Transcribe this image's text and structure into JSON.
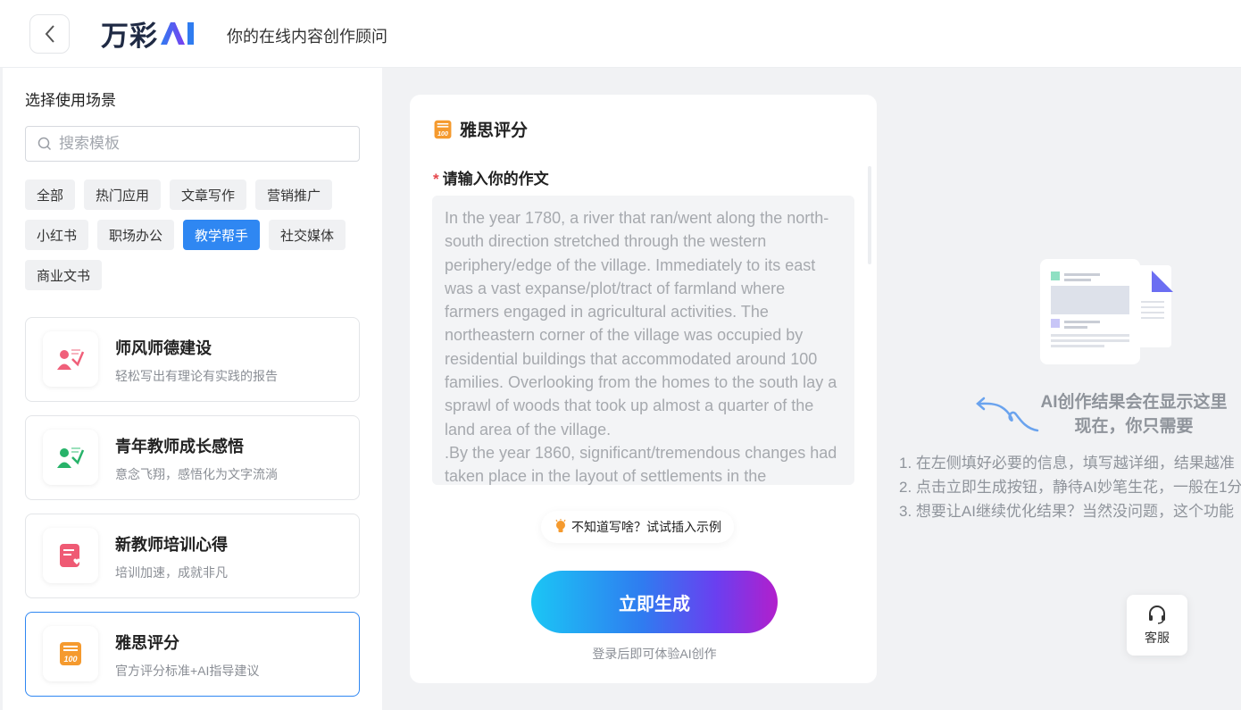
{
  "header": {
    "logo_text": "万彩",
    "logo_ai": "AI",
    "tagline": "你的在线内容创作顾问"
  },
  "sidebar": {
    "title": "选择使用场景",
    "search_placeholder": "搜索模板",
    "tags": [
      {
        "label": "全部",
        "active": false
      },
      {
        "label": "热门应用",
        "active": false
      },
      {
        "label": "文章写作",
        "active": false
      },
      {
        "label": "营销推广",
        "active": false
      },
      {
        "label": "小红书",
        "active": false
      },
      {
        "label": "职场办公",
        "active": false
      },
      {
        "label": "教学帮手",
        "active": true
      },
      {
        "label": "社交媒体",
        "active": false
      },
      {
        "label": "商业文书",
        "active": false
      }
    ],
    "cards": [
      {
        "title": "师风师德建设",
        "desc": "轻松写出有理论有实践的报告",
        "icon": "teacher-red-icon",
        "selected": false
      },
      {
        "title": "青年教师成长感悟",
        "desc": "意念飞翔，感悟化为文字流淌",
        "icon": "teacher-green-icon",
        "selected": false
      },
      {
        "title": "新教师培训心得",
        "desc": "培训加速，成就非凡",
        "icon": "notebook-heart-icon",
        "selected": false
      },
      {
        "title": "雅思评分",
        "desc": "官方评分标准+AI指导建议",
        "icon": "score-100-icon",
        "selected": true
      }
    ]
  },
  "form": {
    "title": "雅思评分",
    "field_label": "请输入你的作文",
    "required_mark": "*",
    "essay": "In the year 1780, a river that ran/went along the north-south direction stretched through the western periphery/edge of the village. Immediately to its east was a vast expanse/plot/tract of farmland where farmers engaged in agricultural activities. The northeastern corner of the village was occupied by residential buildings that accommodated around 100 families. Overlooking from the homes to the south lay a sprawl of woods that took up almost a quarter of the land area of the village.\n.By the year 1860, significant/tremendous changes had taken place in the layout of settlements in the",
    "hint": "不知道写啥？试试插入示例",
    "generate_label": "立即生成",
    "login_note": "登录后即可体验AI创作"
  },
  "result": {
    "title_line1": "AI创作结果会在显示这里",
    "title_line2": "现在，你只需要",
    "tips": [
      "1. 在左侧填好必要的信息，填写越详细，结果越准",
      "2. 点击立即生成按钮，静待AI妙笔生花，一般在1分",
      "3. 想要让AI继续优化结果？当然没问题，这个功能"
    ]
  },
  "support": {
    "label": "客服"
  },
  "colors": {
    "accent": "#2f87f2",
    "required": "#e5484d"
  }
}
